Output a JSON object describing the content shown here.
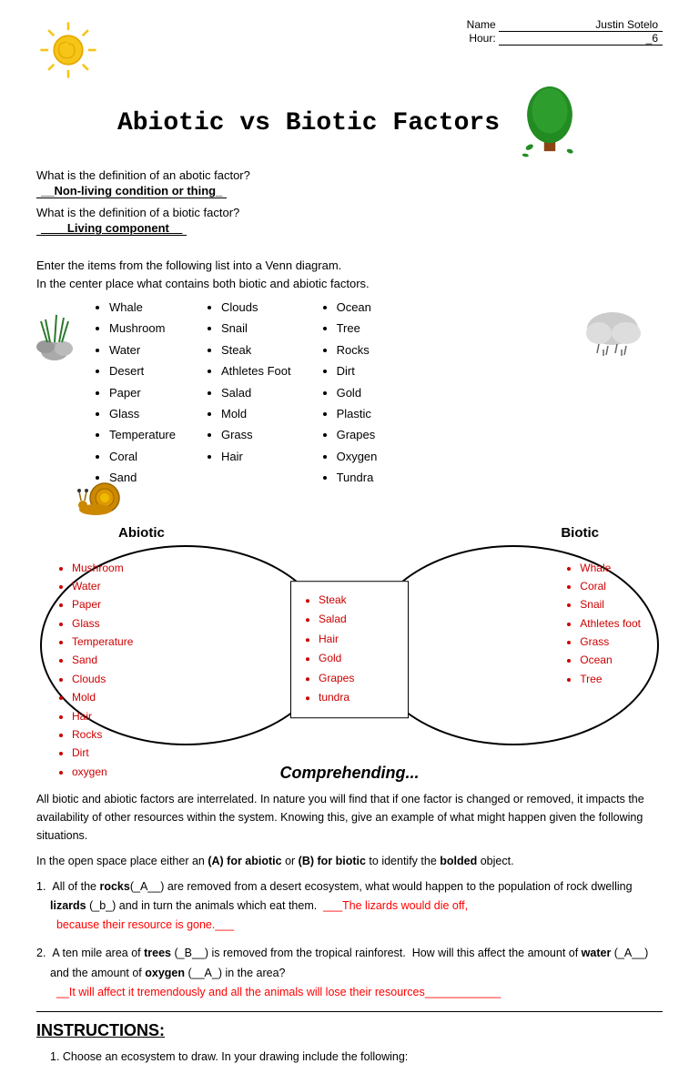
{
  "header": {
    "name_label": "Name",
    "name_value": "Justin Sotelo",
    "hour_label": "Hour:",
    "hour_value": "_6"
  },
  "title": "Abiotic vs Biotic Factors",
  "questions": {
    "q1_label": "What is the definition of an abotic factor?",
    "q1_answer": "__Non-living condition or thing_",
    "q2_label": "What is the definition of a biotic factor?",
    "q2_answer": "____Living component__"
  },
  "venn_instruction": {
    "line1": "Enter the items from the following list into a Venn diagram.",
    "line2": "In the center place what contains both biotic and abiotic factors."
  },
  "items_col1": [
    "Whale",
    "Mushroom",
    "Water",
    "Desert",
    "Paper",
    "Glass",
    "Temperature",
    "Coral",
    "Sand"
  ],
  "items_col2": [
    "Clouds",
    "Snail",
    "Steak",
    "Athletes Foot",
    "Salad",
    "Mold",
    "Grass",
    "Hair"
  ],
  "items_col3": [
    "Ocean",
    "Tree",
    "Rocks",
    "Dirt",
    "Gold",
    "Plastic",
    "Grapes",
    "Oxygen",
    "Tundra"
  ],
  "venn_labels": {
    "left": "Abiotic",
    "right": "Biotic"
  },
  "venn_left": [
    "Mushroom",
    "Water",
    "Paper",
    "Glass",
    "Temperature",
    "Sand",
    "Clouds",
    "Mold",
    "Hair",
    "Rocks",
    "Dirt",
    "oxygen"
  ],
  "venn_center": [
    "Steak",
    "Salad",
    "Hair",
    "Gold",
    "Grapes",
    "tundra"
  ],
  "venn_right": [
    "Whale",
    "Coral",
    "Snail",
    "Athletes foot",
    "Grass",
    "Ocean",
    "Tree"
  ],
  "comprehending": {
    "title": "Comprehending...",
    "paragraph": "All biotic and abiotic factors are interrelated.  In nature you will find that if one factor is changed or removed, it impacts the availability of other resources within the system.  Knowing this, give an example of what might happen given the following situations.",
    "identify_instruction": "In the open space place either an (A) for abiotic or (B) for biotic to identify the bolded object."
  },
  "q_items": [
    {
      "num": "1.",
      "text": "All of the rocks(_A__) are removed from a desert ecosystem, what would happen to the population of rock dwelling lizards (_b_) and in turn the animals which eat them.",
      "red_text": "___The lizards would die off, because their resource is gone.___"
    },
    {
      "num": "2.",
      "text": "A ten mile area of trees (_B__) is removed from the tropical rainforest.  How will this affect the amount of water (_A__) and the amount of oxygen (__A_) in the area?",
      "red_text": "__It will affect it tremendously and all the animals will lose their resources____________"
    }
  ],
  "instructions": {
    "title": "INSTRUCTIONS:",
    "item1": "1.  Choose an ecosystem to draw.  In your drawing include the following:"
  }
}
